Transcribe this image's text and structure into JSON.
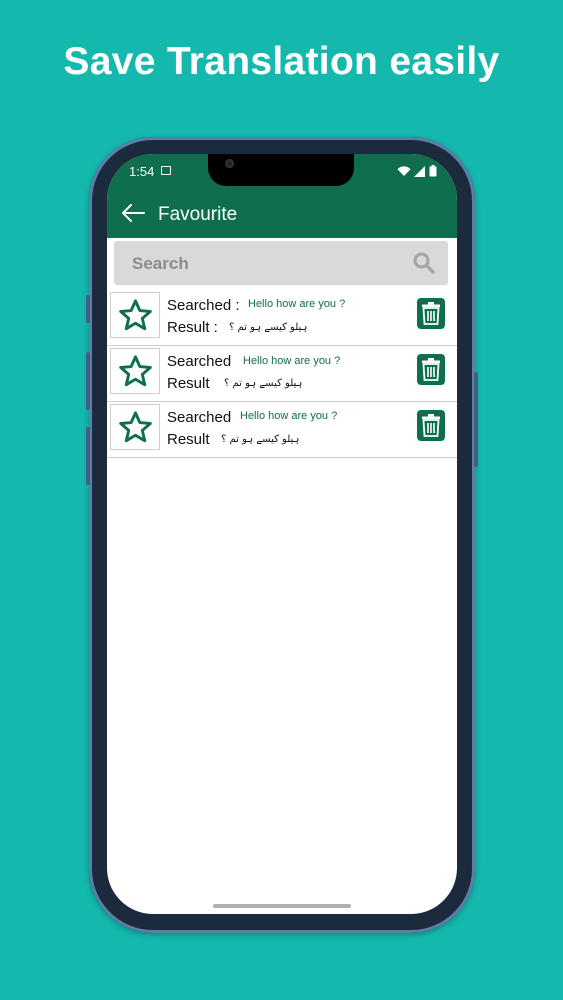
{
  "headline": "Save Translation easily",
  "status": {
    "time": "1:54"
  },
  "appbar": {
    "title": "Favourite"
  },
  "search": {
    "placeholder": "Search"
  },
  "items": [
    {
      "searched_label": "Searched :",
      "searched_text": "Hello how are you ?",
      "result_label": "Result  :",
      "result_text": "ہیلو کیسے ہو تم ؟"
    },
    {
      "searched_label": "Searched",
      "searched_text": "Hello how are you ?",
      "result_label": "Result",
      "result_text": "ہیلو کیسے ہو تم ؟"
    },
    {
      "searched_label": "Searched",
      "searched_text": "Hello how are you ?",
      "result_label": "Result",
      "result_text": "ہیلو کیسے ہو تم ؟"
    }
  ],
  "colors": {
    "background": "#14b8ad",
    "primary": "#0f6e4e",
    "search_bg": "#d9d9dc"
  },
  "icons": [
    "back-arrow-icon",
    "search-icon",
    "star-icon",
    "trash-icon",
    "wifi-icon",
    "signal-icon",
    "battery-icon",
    "image-icon"
  ]
}
